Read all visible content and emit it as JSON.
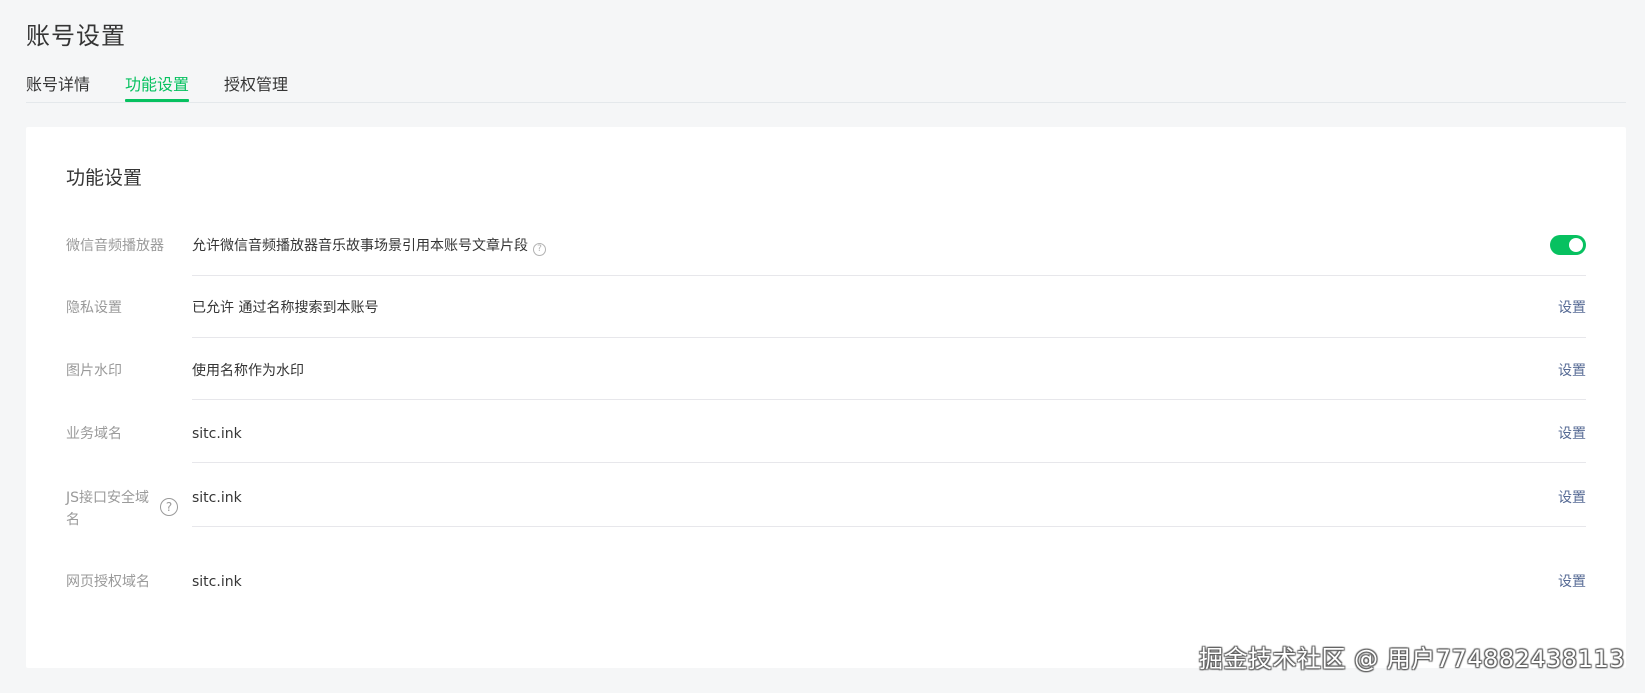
{
  "page": {
    "title": "账号设置"
  },
  "tabs": [
    {
      "label": "账号详情",
      "active": false
    },
    {
      "label": "功能设置",
      "active": true
    },
    {
      "label": "授权管理",
      "active": false
    }
  ],
  "card": {
    "title": "功能设置",
    "rows": [
      {
        "label": "微信音频播放器",
        "value": "允许微信音频播放器音乐故事场景引用本账号文章片段",
        "help_icon": "question-circle-icon",
        "control": "toggle",
        "toggle_on": true
      },
      {
        "label": "隐私设置",
        "value": "已允许 通过名称搜索到本账号",
        "action": "设置"
      },
      {
        "label": "图片水印",
        "value": "使用名称作为水印",
        "action": "设置"
      },
      {
        "label": "业务域名",
        "value": "sitc.ink",
        "action": "设置"
      },
      {
        "label_line1": "JS接口安全域",
        "label_line2": "名",
        "label_help_icon": "question-circle-icon",
        "value": "sitc.ink",
        "action": "设置"
      },
      {
        "label": "网页授权域名",
        "value": "sitc.ink",
        "action": "设置"
      }
    ]
  },
  "watermark": {
    "text": "掘金技术社区 @ 用户774882438113"
  },
  "colors": {
    "accent": "#07c160",
    "link": "#576b95",
    "label": "#9a9a9a",
    "text": "#353535",
    "background": "#f5f6f7"
  }
}
